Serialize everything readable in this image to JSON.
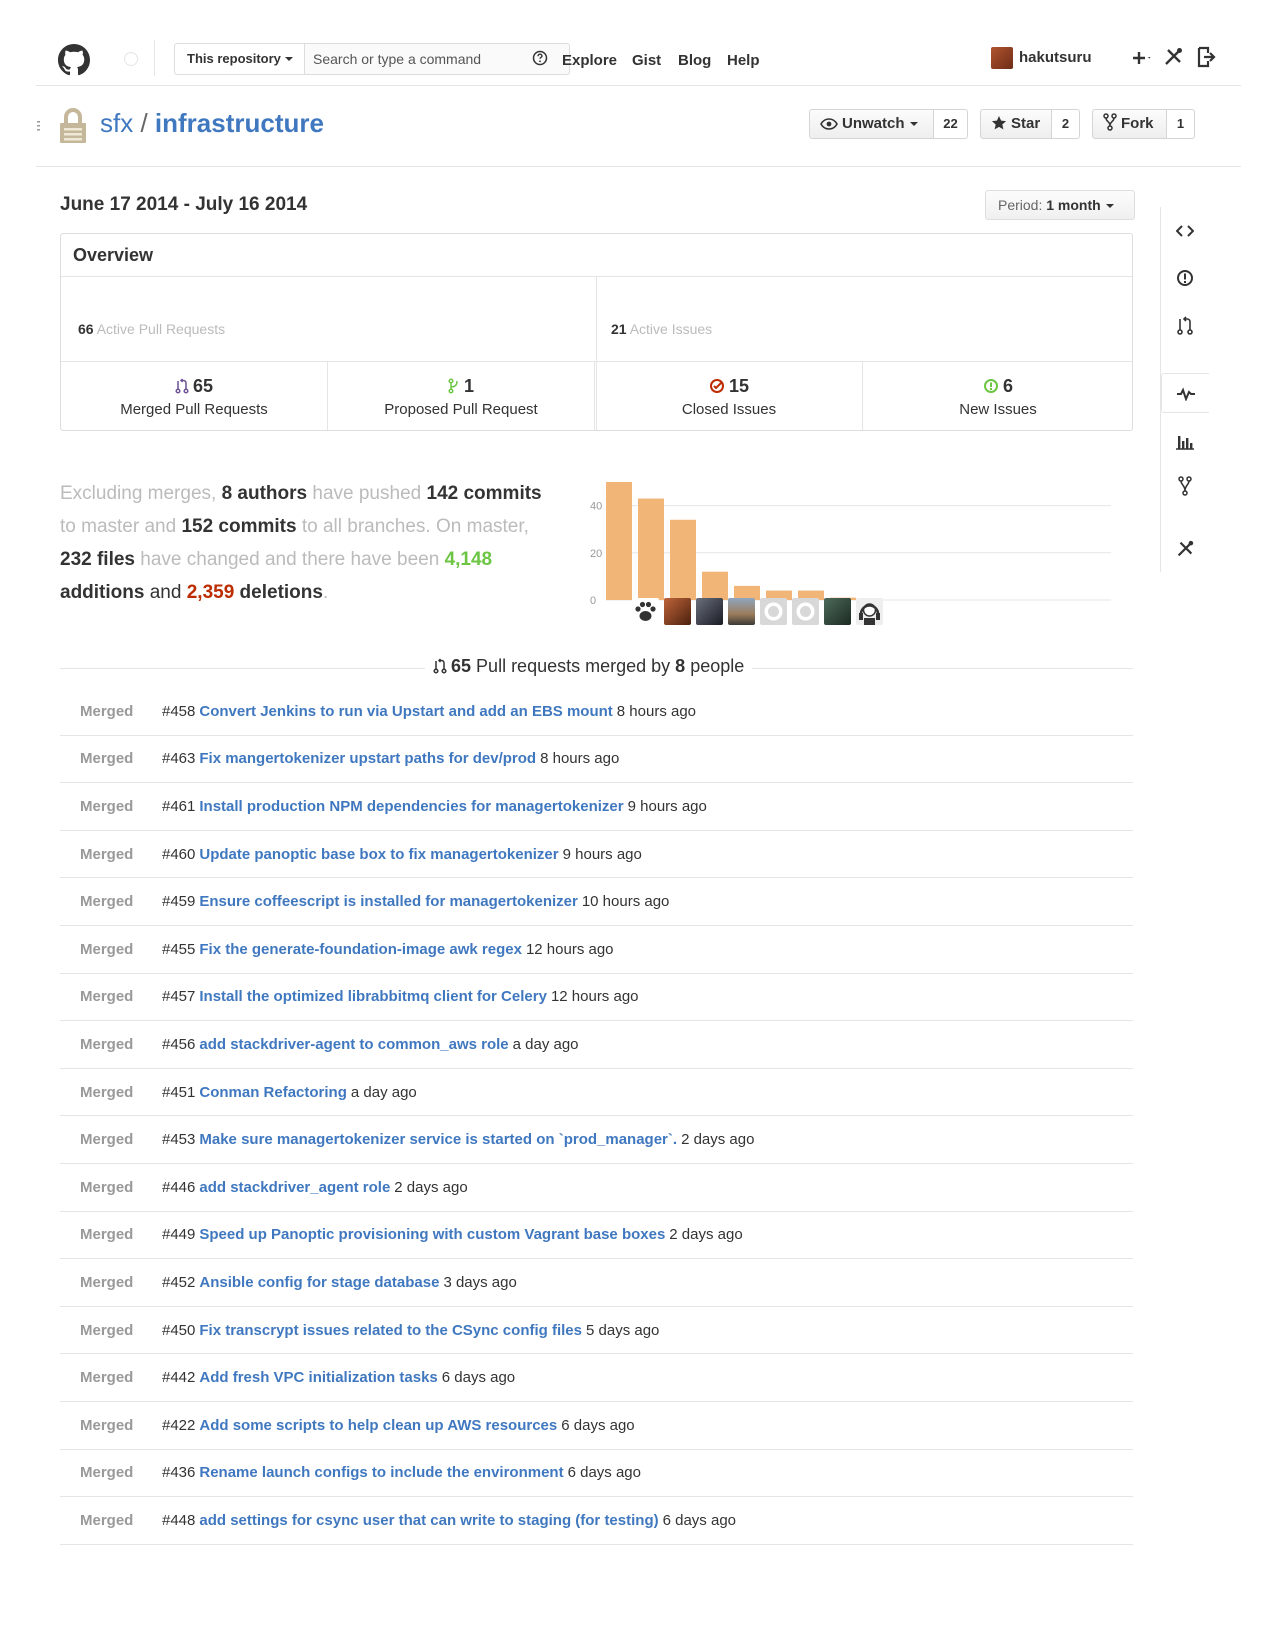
{
  "header": {
    "search_scope": "This repository",
    "search_placeholder": "Search or type a command",
    "nav": [
      "Explore",
      "Gist",
      "Blog",
      "Help"
    ],
    "username": "hakutsuru"
  },
  "repo": {
    "owner": "sfx",
    "separator": " / ",
    "name": "infrastructure",
    "watch_label": "Unwatch",
    "watch_count": "22",
    "star_label": "Star",
    "star_count": "2",
    "fork_label": "Fork",
    "fork_count": "1"
  },
  "pulse": {
    "date_range": "June 17 2014 - July 16 2014",
    "period_label": "Period:",
    "period_value": "1 month"
  },
  "overview": {
    "title": "Overview",
    "active_prs_count": "66",
    "active_prs_label": "Active Pull Requests",
    "active_issues_count": "21",
    "active_issues_label": "Active Issues",
    "stats": [
      {
        "value": "65",
        "label": "Merged Pull Requests",
        "color": "#6e5494"
      },
      {
        "value": "1",
        "label": "Proposed Pull Request",
        "color": "#6cc644"
      },
      {
        "value": "15",
        "label": "Closed Issues",
        "color": "#bd2c00"
      },
      {
        "value": "6",
        "label": "New Issues",
        "color": "#6cc644"
      }
    ]
  },
  "summary": {
    "p1": "Excluding merges,",
    "authors": "8 authors",
    "p2": "have pushed",
    "commits_master": "142 commits",
    "p3": "to master and",
    "commits_all": "152 commits",
    "p4": "to all branches. On master,",
    "files_num": "232",
    "files_word": "files",
    "p5": "have changed and there have been",
    "additions_num": "4,148",
    "additions_word": "additions",
    "p6": "and",
    "deletions_num": "2,359",
    "deletions_word": "deletions",
    "p7": "."
  },
  "chart_data": {
    "type": "bar",
    "values": [
      50,
      43,
      34,
      12,
      6,
      4,
      4,
      1
    ],
    "ylim": [
      0,
      50
    ],
    "yticks": [
      0,
      20,
      40
    ],
    "bar_color": "#f0b577"
  },
  "merged": {
    "count": "65",
    "label_mid": "Pull requests merged by",
    "people": "8",
    "label_end": "people",
    "items": [
      {
        "state": "Merged",
        "num": "#458",
        "title": "Convert Jenkins to run via Upstart and add an EBS mount",
        "time": "8 hours ago"
      },
      {
        "state": "Merged",
        "num": "#463",
        "title": "Fix mangertokenizer upstart paths for dev/prod",
        "time": "8 hours ago"
      },
      {
        "state": "Merged",
        "num": "#461",
        "title": "Install production NPM dependencies for managertokenizer",
        "time": "9 hours ago"
      },
      {
        "state": "Merged",
        "num": "#460",
        "title": "Update panoptic base box to fix managertokenizer",
        "time": "9 hours ago"
      },
      {
        "state": "Merged",
        "num": "#459",
        "title": "Ensure coffeescript is installed for managertokenizer",
        "time": "10 hours ago"
      },
      {
        "state": "Merged",
        "num": "#455",
        "title": "Fix the generate-foundation-image awk regex",
        "time": "12 hours ago"
      },
      {
        "state": "Merged",
        "num": "#457",
        "title": "Install the optimized librabbitmq client for Celery",
        "time": "12 hours ago"
      },
      {
        "state": "Merged",
        "num": "#456",
        "title": "add stackdriver-agent to common_aws role",
        "time": "a day ago"
      },
      {
        "state": "Merged",
        "num": "#451",
        "title": "Conman Refactoring",
        "time": "a day ago"
      },
      {
        "state": "Merged",
        "num": "#453",
        "title": "Make sure managertokenizer service is started on `prod_manager`.",
        "time": "2 days ago"
      },
      {
        "state": "Merged",
        "num": "#446",
        "title": "add stackdriver_agent role",
        "time": "2 days ago"
      },
      {
        "state": "Merged",
        "num": "#449",
        "title": "Speed up Panoptic provisioning with custom Vagrant base boxes",
        "time": "2 days ago"
      },
      {
        "state": "Merged",
        "num": "#452",
        "title": "Ansible config for stage database",
        "time": "3 days ago"
      },
      {
        "state": "Merged",
        "num": "#450",
        "title": "Fix transcrypt issues related to the CSync config files",
        "time": "5 days ago"
      },
      {
        "state": "Merged",
        "num": "#442",
        "title": "Add fresh VPC initialization tasks",
        "time": "6 days ago"
      },
      {
        "state": "Merged",
        "num": "#422",
        "title": "Add some scripts to help clean up AWS resources",
        "time": "6 days ago"
      },
      {
        "state": "Merged",
        "num": "#436",
        "title": "Rename launch configs to include the environment",
        "time": "6 days ago"
      },
      {
        "state": "Merged",
        "num": "#448",
        "title": "add settings for csync user that can write to staging (for testing)",
        "time": "6 days ago"
      }
    ]
  },
  "sidenav": [
    "code-icon",
    "issues-icon",
    "pull-requests-icon",
    "pulse-icon",
    "graphs-icon",
    "network-icon",
    "settings-icon"
  ]
}
